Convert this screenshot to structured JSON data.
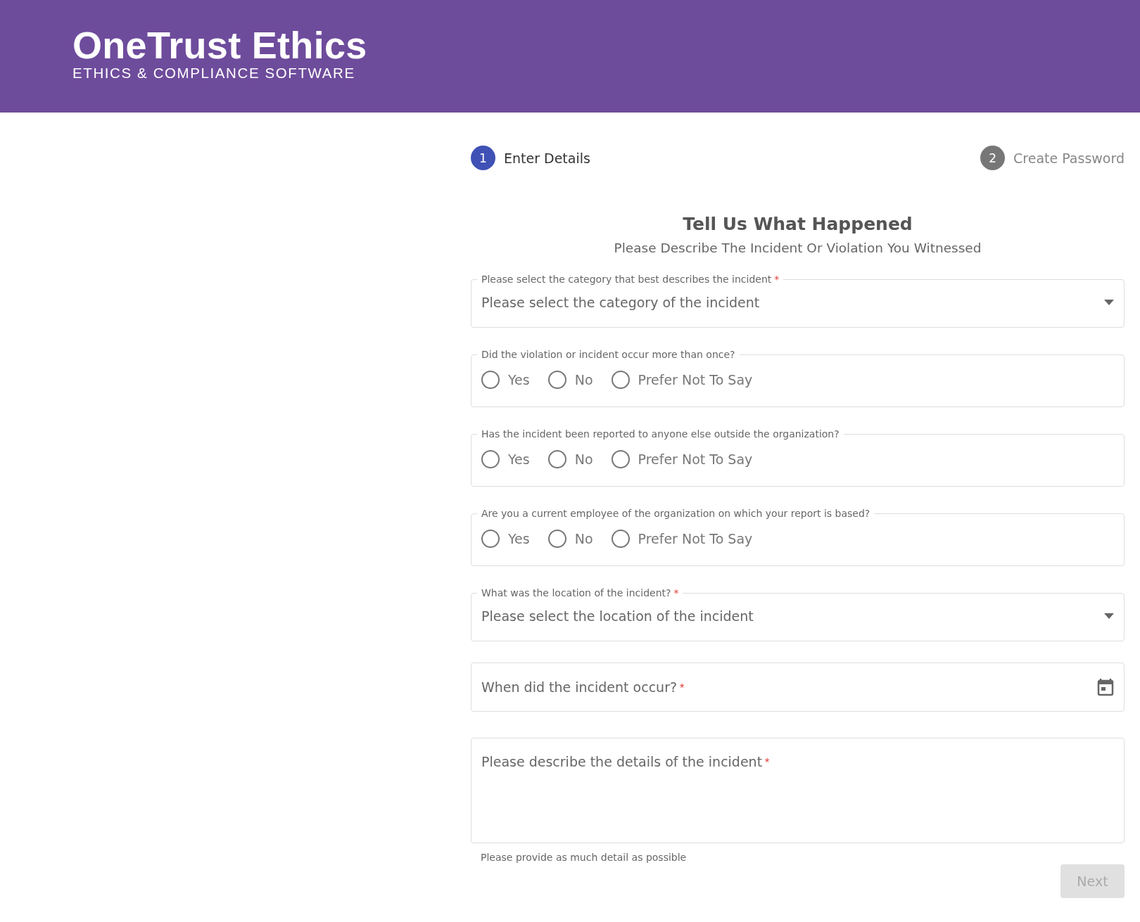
{
  "header": {
    "logo_title": "OneTrust Ethics",
    "logo_subtitle": "ETHICS & COMPLIANCE SOFTWARE"
  },
  "steps": [
    {
      "number": "1",
      "label": "Enter Details",
      "selected": true
    },
    {
      "number": "2",
      "label": "Create Password",
      "selected": false
    }
  ],
  "form": {
    "title": "Tell Us What Happened",
    "subtitle": "Please Describe The Incident Or Violation You Witnessed",
    "fields": [
      {
        "kind": "select",
        "label": "Please select the category that best describes the incident",
        "required_mark": "*",
        "placeholder": "Please select the category of the incident"
      },
      {
        "kind": "radio",
        "label": "Did the violation or incident occur more than once?",
        "options": [
          {
            "label": "Yes",
            "selected": false
          },
          {
            "label": "No",
            "selected": false
          },
          {
            "label": "Prefer Not To Say",
            "selected": false
          }
        ]
      },
      {
        "kind": "radio",
        "label": "Has the incident been reported to anyone else outside the organization?",
        "options": [
          {
            "label": "Yes",
            "selected": false
          },
          {
            "label": "No",
            "selected": false
          },
          {
            "label": "Prefer Not To Say",
            "selected": false
          }
        ]
      },
      {
        "kind": "radio",
        "label": "Are you a current employee of the organization on which your report is based?",
        "options": [
          {
            "label": "Yes",
            "selected": false
          },
          {
            "label": "No",
            "selected": false
          },
          {
            "label": "Prefer Not To Say",
            "selected": false
          }
        ]
      },
      {
        "kind": "select",
        "label": "What was the location of the incident?",
        "required_mark": "*",
        "placeholder": "Please select the location of the incident"
      },
      {
        "kind": "date",
        "placeholder": "When did the incident occur?",
        "required_mark": "*"
      },
      {
        "kind": "textarea",
        "placeholder": "Please describe the details of the incident",
        "required_mark": "*",
        "hint": "Please provide as much detail as possible"
      }
    ],
    "next_button": {
      "label": "Next",
      "disabled": true
    }
  }
}
